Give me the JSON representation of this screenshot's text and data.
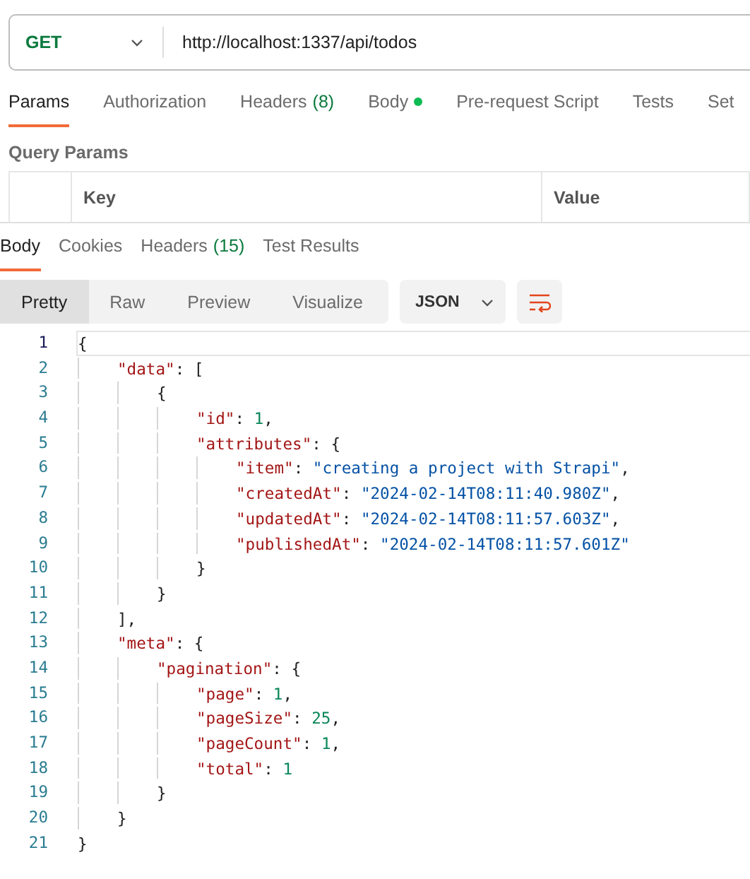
{
  "request": {
    "method": "GET",
    "url": "http://localhost:1337/api/todos"
  },
  "request_tabs": [
    {
      "label": "Params",
      "selected": true,
      "dot": false
    },
    {
      "label": "Authorization",
      "selected": false,
      "dot": false
    },
    {
      "label": "Headers",
      "count": "(8)",
      "selected": false,
      "dot": false
    },
    {
      "label": "Body",
      "selected": false,
      "dot": true
    },
    {
      "label": "Pre-request Script",
      "selected": false,
      "dot": false
    },
    {
      "label": "Tests",
      "selected": false,
      "dot": false
    },
    {
      "label": "Set",
      "selected": false,
      "dot": false
    }
  ],
  "query_params": {
    "title": "Query Params",
    "columns": [
      "Key",
      "Value"
    ]
  },
  "response_tabs": [
    {
      "label": "Body",
      "selected": true
    },
    {
      "label": "Cookies",
      "selected": false
    },
    {
      "label": "Headers",
      "count": "(15)",
      "selected": false
    },
    {
      "label": "Test Results",
      "selected": false
    }
  ],
  "view_modes": [
    {
      "label": "Pretty",
      "selected": true
    },
    {
      "label": "Raw",
      "selected": false
    },
    {
      "label": "Preview",
      "selected": false
    },
    {
      "label": "Visualize",
      "selected": false
    }
  ],
  "format": "JSON",
  "code_lines": [
    {
      "number": "1",
      "selected": true,
      "tokens": [
        {
          "kind": "punct",
          "text": "{"
        }
      ]
    },
    {
      "number": "2",
      "selected": false,
      "tokens": [
        {
          "kind": "key",
          "text": "\"data\""
        },
        {
          "kind": "punct",
          "text": ": ["
        }
      ]
    },
    {
      "number": "3",
      "selected": false,
      "tokens": [
        {
          "kind": "punct",
          "text": "{"
        }
      ]
    },
    {
      "number": "4",
      "selected": false,
      "tokens": [
        {
          "kind": "key",
          "text": "\"id\""
        },
        {
          "kind": "punct",
          "text": ": "
        },
        {
          "kind": "number",
          "text": "1"
        },
        {
          "kind": "punct",
          "text": ","
        }
      ]
    },
    {
      "number": "5",
      "selected": false,
      "tokens": [
        {
          "kind": "key",
          "text": "\"attributes\""
        },
        {
          "kind": "punct",
          "text": ": {"
        }
      ]
    },
    {
      "number": "6",
      "selected": false,
      "tokens": [
        {
          "kind": "key",
          "text": "\"item\""
        },
        {
          "kind": "punct",
          "text": ": "
        },
        {
          "kind": "string",
          "text": "\"creating a project with Strapi\""
        },
        {
          "kind": "punct",
          "text": ","
        }
      ]
    },
    {
      "number": "7",
      "selected": false,
      "tokens": [
        {
          "kind": "key",
          "text": "\"createdAt\""
        },
        {
          "kind": "punct",
          "text": ": "
        },
        {
          "kind": "string",
          "text": "\"2024-02-14T08:11:40.980Z\""
        },
        {
          "kind": "punct",
          "text": ","
        }
      ]
    },
    {
      "number": "8",
      "selected": false,
      "tokens": [
        {
          "kind": "key",
          "text": "\"updatedAt\""
        },
        {
          "kind": "punct",
          "text": ": "
        },
        {
          "kind": "string",
          "text": "\"2024-02-14T08:11:57.603Z\""
        },
        {
          "kind": "punct",
          "text": ","
        }
      ]
    },
    {
      "number": "9",
      "selected": false,
      "tokens": [
        {
          "kind": "key",
          "text": "\"publishedAt\""
        },
        {
          "kind": "punct",
          "text": ": "
        },
        {
          "kind": "string",
          "text": "\"2024-02-14T08:11:57.601Z\""
        }
      ]
    },
    {
      "number": "10",
      "selected": false,
      "tokens": [
        {
          "kind": "punct",
          "text": "}"
        }
      ]
    },
    {
      "number": "11",
      "selected": false,
      "tokens": [
        {
          "kind": "punct",
          "text": "}"
        }
      ]
    },
    {
      "number": "12",
      "selected": false,
      "tokens": [
        {
          "kind": "punct",
          "text": "],"
        }
      ]
    },
    {
      "number": "13",
      "selected": false,
      "tokens": [
        {
          "kind": "key",
          "text": "\"meta\""
        },
        {
          "kind": "punct",
          "text": ": {"
        }
      ]
    },
    {
      "number": "14",
      "selected": false,
      "tokens": [
        {
          "kind": "key",
          "text": "\"pagination\""
        },
        {
          "kind": "punct",
          "text": ": {"
        }
      ]
    },
    {
      "number": "15",
      "selected": false,
      "tokens": [
        {
          "kind": "key",
          "text": "\"page\""
        },
        {
          "kind": "punct",
          "text": ": "
        },
        {
          "kind": "number",
          "text": "1"
        },
        {
          "kind": "punct",
          "text": ","
        }
      ]
    },
    {
      "number": "16",
      "selected": false,
      "tokens": [
        {
          "kind": "key",
          "text": "\"pageSize\""
        },
        {
          "kind": "punct",
          "text": ": "
        },
        {
          "kind": "number",
          "text": "25"
        },
        {
          "kind": "punct",
          "text": ","
        }
      ]
    },
    {
      "number": "17",
      "selected": false,
      "tokens": [
        {
          "kind": "key",
          "text": "\"pageCount\""
        },
        {
          "kind": "punct",
          "text": ": "
        },
        {
          "kind": "number",
          "text": "1"
        },
        {
          "kind": "punct",
          "text": ","
        }
      ]
    },
    {
      "number": "18",
      "selected": false,
      "tokens": [
        {
          "kind": "key",
          "text": "\"total\""
        },
        {
          "kind": "punct",
          "text": ": "
        },
        {
          "kind": "number",
          "text": "1"
        }
      ]
    },
    {
      "number": "19",
      "selected": false,
      "tokens": [
        {
          "kind": "punct",
          "text": "}"
        }
      ]
    },
    {
      "number": "20",
      "selected": false,
      "tokens": [
        {
          "kind": "punct",
          "text": "}"
        }
      ]
    },
    {
      "number": "21",
      "selected": false,
      "tokens": [
        {
          "kind": "punct",
          "text": "}"
        }
      ]
    }
  ]
}
